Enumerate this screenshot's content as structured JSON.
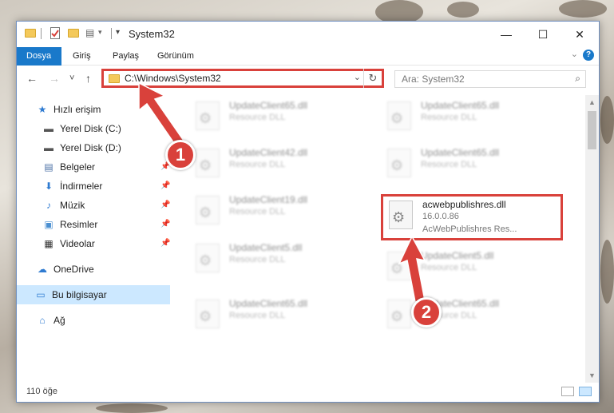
{
  "window": {
    "title": "System32",
    "controls": {
      "minimize": "—",
      "maximize": "☐",
      "close": "✕"
    }
  },
  "ribbon": {
    "tabs": [
      "Dosya",
      "Giriş",
      "Paylaş",
      "Görünüm"
    ],
    "help": "?"
  },
  "nav": {
    "back": "←",
    "forward": "→",
    "recent": "˅",
    "up": "↑",
    "address": "C:\\Windows\\System32",
    "search_placeholder": "Ara: System32"
  },
  "sidebar": {
    "items": [
      {
        "label": "Hızlı erişim",
        "icon": "star-icon"
      },
      {
        "label": "Yerel Disk (C:)",
        "icon": "drive-icon"
      },
      {
        "label": "Yerel Disk (D:)",
        "icon": "drive-icon"
      },
      {
        "label": "Belgeler",
        "icon": "documents-icon"
      },
      {
        "label": "İndirmeler",
        "icon": "download-icon"
      },
      {
        "label": "Müzik",
        "icon": "music-icon"
      },
      {
        "label": "Resimler",
        "icon": "pictures-icon"
      },
      {
        "label": "Videolar",
        "icon": "videos-icon"
      },
      {
        "label": "OneDrive",
        "icon": "cloud-icon"
      },
      {
        "label": "Bu bilgisayar",
        "icon": "computer-icon"
      },
      {
        "label": "Ağ",
        "icon": "network-icon"
      }
    ]
  },
  "files": [
    {
      "name": "UpdateClient65.dll",
      "type": "Resource DLL"
    },
    {
      "name": "UpdateClient65.dll",
      "type": "Resource DLL"
    },
    {
      "name": "UpdateClient42.dll",
      "type": "Resource DLL"
    },
    {
      "name": "UpdateClient65.dll",
      "type": "Resource DLL"
    },
    {
      "name": "UpdateClient19.dll",
      "type": "Resource DLL"
    },
    {
      "name": "acwebpublishres.dll",
      "version": "16.0.0.86",
      "description": "AcWebPublishres Res..."
    },
    {
      "name": "UpdateClient5.dll",
      "type": "Resource DLL"
    },
    {
      "name": "UpdateClient5.dll",
      "type": "Resource DLL"
    },
    {
      "name": "UpdateClient65.dll",
      "type": "Resource DLL"
    },
    {
      "name": "UpdateClient65.dll",
      "type": "Resource DLL"
    }
  ],
  "status": {
    "count": "110 öğe"
  },
  "annotations": {
    "step1": "1",
    "step2": "2"
  },
  "colors": {
    "accent": "#1979ca",
    "highlight": "#d9413b",
    "selected": "#cce8ff"
  }
}
